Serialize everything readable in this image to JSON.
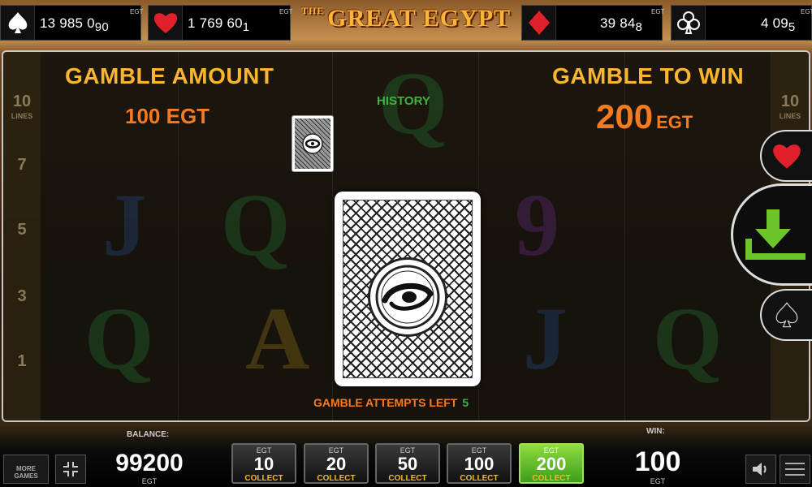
{
  "jackpots": [
    {
      "suit": "spade-icon",
      "value": "13 985 0",
      "cents": "90",
      "egt": "EGT",
      "suit_color": "#ffffff"
    },
    {
      "suit": "heart-icon",
      "value": "1 769 60",
      "cents": "1",
      "egt": "EGT",
      "suit_color": "#e0202a"
    },
    {
      "suit": "diamond-icon",
      "value": "39 84",
      "cents": "8",
      "egt": "EGT",
      "suit_color": "#e0202a"
    },
    {
      "suit": "club-icon",
      "value": "4 09",
      "cents": "5",
      "egt": "EGT",
      "suit_color": "#ffffff"
    }
  ],
  "logo": {
    "the": "THE",
    "name": "GREAT EGYPT"
  },
  "gamble": {
    "amount_title": "GAMBLE AMOUNT",
    "amount_value": "100 EGT",
    "win_title": "GAMBLE TO WIN",
    "win_value": "200",
    "win_unit": "EGT",
    "history_label": "HISTORY",
    "attempts_label": "GAMBLE ATTEMPTS LEFT",
    "attempts_value": "5"
  },
  "side_lines": {
    "lines_count": "10",
    "lines_word": "LINES",
    "numbers": [
      "7",
      "5",
      "3",
      "1"
    ]
  },
  "choices": {
    "red": "heart-icon",
    "collect": "collect-arrow-icon",
    "black": "spade-icon"
  },
  "bottom": {
    "more_games": "MORE GAMES",
    "balance_label": "BALANCE:",
    "balance_value": "99200",
    "balance_unit": "EGT",
    "win_label": "WIN:",
    "win_value": "100",
    "win_unit": "EGT",
    "denominations": [
      {
        "top": "EGT",
        "value": "10",
        "action": "COLLECT"
      },
      {
        "top": "EGT",
        "value": "20",
        "action": "COLLECT"
      },
      {
        "top": "EGT",
        "value": "50",
        "action": "COLLECT"
      },
      {
        "top": "EGT",
        "value": "100",
        "action": "COLLECT"
      },
      {
        "top": "EGT",
        "value": "200",
        "action": "COLLECT"
      }
    ]
  },
  "colors": {
    "title_gold": "#f9b72c",
    "amount_orange": "#f47b20",
    "history_green": "#3fb23f",
    "active_denom_green": "#5bbf2a"
  }
}
